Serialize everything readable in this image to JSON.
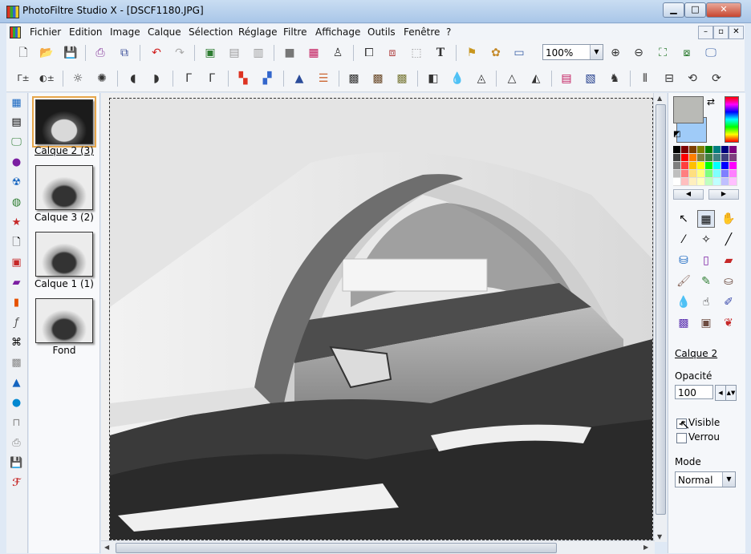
{
  "window": {
    "title": "PhotoFiltre Studio X - [DSCF1180.JPG]",
    "minimize": "▁",
    "maximize": "□",
    "close": "✕"
  },
  "menu": {
    "items": [
      "Fichier",
      "Edition",
      "Image",
      "Calque",
      "Sélection",
      "Réglage",
      "Filtre",
      "Affichage",
      "Outils",
      "Fenêtre",
      "?"
    ],
    "mdi_buttons": [
      "–",
      "▫",
      "✕"
    ]
  },
  "toolbar": {
    "zoom_value": "100%",
    "text_tool_glyph": "T"
  },
  "layers": [
    {
      "label": "Calque 2 (3)",
      "selected": true
    },
    {
      "label": "Calque 3 (2)",
      "selected": false
    },
    {
      "label": "Calque 1 (1)",
      "selected": false
    },
    {
      "label": "Fond",
      "selected": false
    }
  ],
  "right_panel": {
    "layer_name": "Calque 2",
    "opacity_label": "Opacité",
    "opacity_value": "100",
    "visible_label": "Visible",
    "visible_checked": true,
    "lock_label": "Verrou",
    "lock_checked": false,
    "mode_label": "Mode",
    "mode_value": "Normal",
    "foreground_color": "#b9bab6",
    "background_color": "#9fcbf8"
  },
  "palette_colors": [
    "#000000",
    "#7f0000",
    "#7f3f00",
    "#7f7f00",
    "#007f00",
    "#007f7f",
    "#00007f",
    "#7f007f",
    "#3f3f3f",
    "#ff0000",
    "#ff7f00",
    "#7f7f3f",
    "#3f7f3f",
    "#3f7f7f",
    "#3f3f7f",
    "#7f3f7f",
    "#7f7f7f",
    "#ff3f3f",
    "#ffbf00",
    "#ffff00",
    "#00ff00",
    "#00ffff",
    "#0000ff",
    "#ff00ff",
    "#bfbfbf",
    "#ff7f7f",
    "#ffdf7f",
    "#ffff7f",
    "#7fff7f",
    "#7fffff",
    "#7f7fff",
    "#ff7fff",
    "#ffffff",
    "#ffbfbf",
    "#ffefbf",
    "#ffffbf",
    "#bfffbf",
    "#bfffff",
    "#bfbfff",
    "#ffbfff"
  ]
}
